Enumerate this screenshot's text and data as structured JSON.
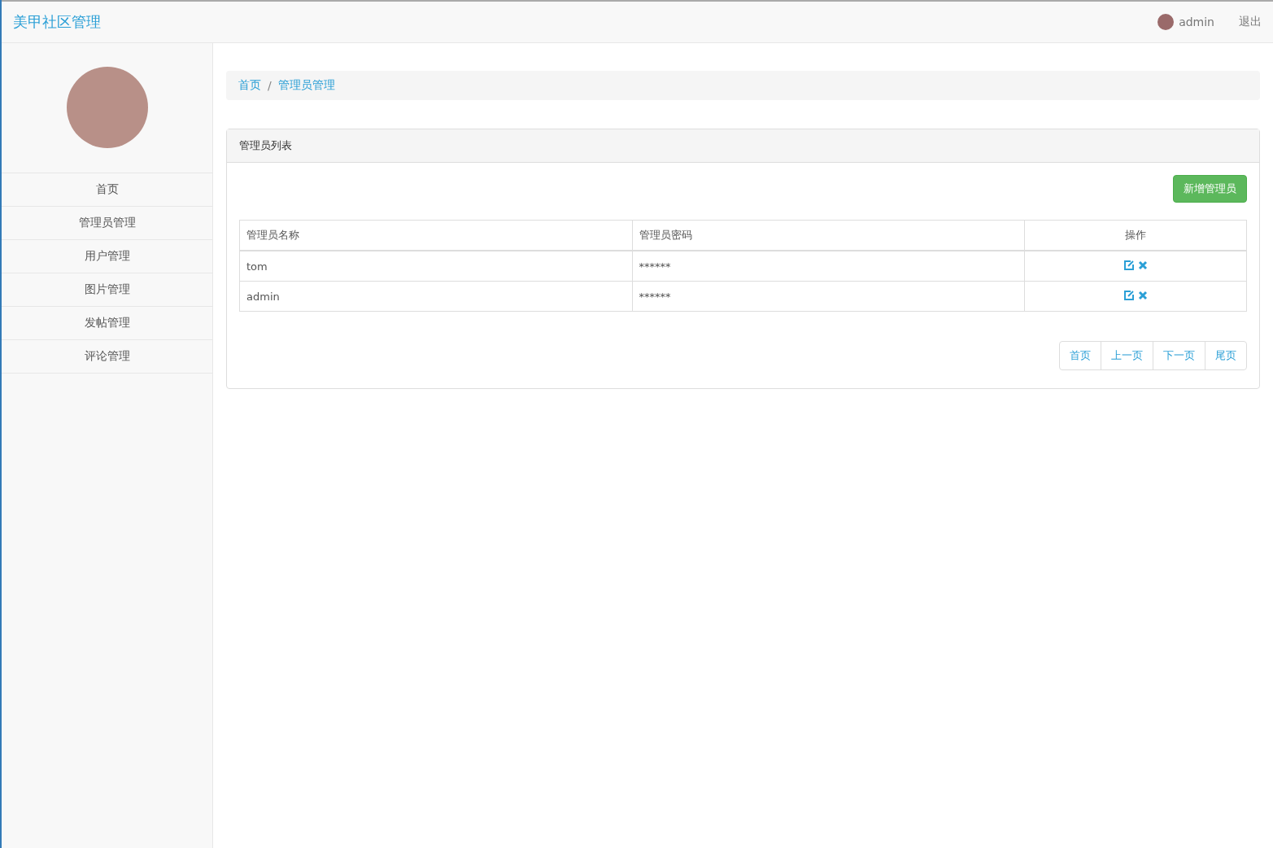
{
  "header": {
    "brand": "美甲社区管理",
    "user": "admin",
    "logout": "退出"
  },
  "sidebar": {
    "items": [
      "首页",
      "管理员管理",
      "用户管理",
      "图片管理",
      "发帖管理",
      "评论管理"
    ]
  },
  "breadcrumb": {
    "separator": "/",
    "items": [
      "首页",
      "管理员管理"
    ]
  },
  "panel": {
    "title": "管理员列表",
    "add_button": "新增管理员",
    "table": {
      "columns": [
        "管理员名称",
        "管理员密码",
        "操作"
      ],
      "rows": [
        {
          "name": "tom",
          "password": "******"
        },
        {
          "name": "admin",
          "password": "******"
        }
      ]
    },
    "pagination": [
      "首页",
      "上一页",
      "下一页",
      "尾页"
    ]
  }
}
